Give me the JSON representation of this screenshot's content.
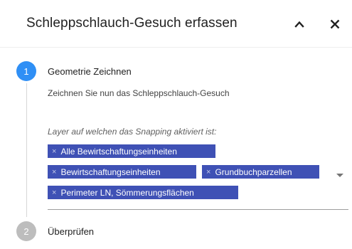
{
  "panel": {
    "title": "Schleppschlauch-Gesuch erfassen"
  },
  "header_icons": {
    "collapse": "chevron-up-icon",
    "close": "close-icon"
  },
  "steps": [
    {
      "number": "1",
      "label": "Geometrie Zeichnen",
      "state": "active",
      "color": "#2f8ff5"
    },
    {
      "number": "2",
      "label": "Überprüfen",
      "state": "inactive",
      "color": "#bdbdbd"
    }
  ],
  "draw_step": {
    "instruction": "Zeichnen Sie nun das Schleppschlauch-Gesuch",
    "snapping_label": "Layer auf welchen das Snapping aktiviert ist:",
    "chips": [
      "Alle Bewirtschaftungseinheiten",
      "Bewirtschaftungseinheiten",
      "Grundbuchparzellen",
      "Perimeter LN, Sömmerungsflächen"
    ],
    "chip_remove_glyph": "×"
  },
  "colors": {
    "accent": "#2f8ff5",
    "chip": "#3f51b5"
  }
}
